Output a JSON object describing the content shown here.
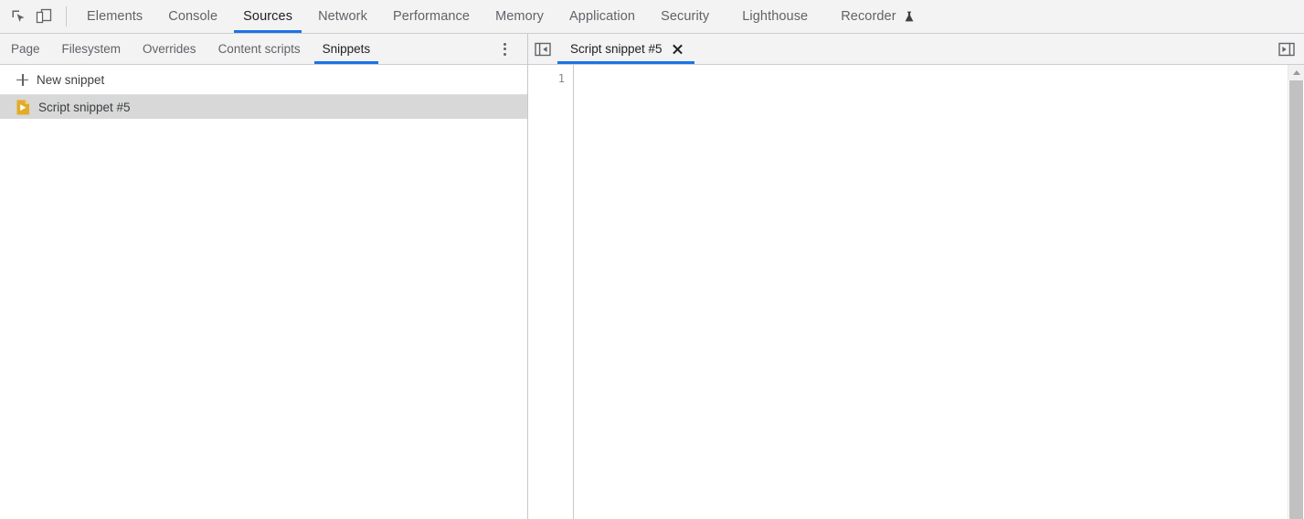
{
  "colors": {
    "accent": "#1a73e8",
    "toolbar_bg": "#f3f3f3",
    "selected_row_bg": "#d8d8d8",
    "snippet_icon": "#e2ac26",
    "text_default": "#5f6368",
    "text_active": "#202124",
    "scrollbar_thumb": "#c1c1c1"
  },
  "main_toolbar": {
    "inspect_icon": "inspect-element-icon",
    "device_icon": "device-toolbar-icon",
    "tabs": [
      {
        "label": "Elements",
        "selected": false
      },
      {
        "label": "Console",
        "selected": false
      },
      {
        "label": "Sources",
        "selected": true
      },
      {
        "label": "Network",
        "selected": false
      },
      {
        "label": "Performance",
        "selected": false
      },
      {
        "label": "Memory",
        "selected": false
      },
      {
        "label": "Application",
        "selected": false
      },
      {
        "label": "Security",
        "selected": false
      },
      {
        "label": "Lighthouse",
        "selected": false
      },
      {
        "label": "Recorder",
        "selected": false,
        "experimental_icon": "flask-icon"
      }
    ]
  },
  "navigator": {
    "tabs": [
      {
        "label": "Page",
        "selected": false
      },
      {
        "label": "Filesystem",
        "selected": false
      },
      {
        "label": "Overrides",
        "selected": false
      },
      {
        "label": "Content scripts",
        "selected": false
      },
      {
        "label": "Snippets",
        "selected": true
      }
    ],
    "more_options_icon": "more-options-icon",
    "new_snippet_label": "New snippet",
    "new_snippet_icon": "plus-icon",
    "files": [
      {
        "name": "Script snippet #5",
        "icon": "script-snippet-icon",
        "selected": true
      }
    ]
  },
  "editor": {
    "navigator_toggle_icon": "show-navigator-icon",
    "debugger_toggle_icon": "show-debugger-sidebar-icon",
    "tabs": [
      {
        "label": "Script snippet #5",
        "selected": true,
        "close_icon": "close-icon"
      }
    ],
    "line_numbers": [
      "1"
    ],
    "lines": [
      ""
    ],
    "scrollbar": {
      "up_arrow_icon": "scroll-up-arrow-icon"
    }
  }
}
